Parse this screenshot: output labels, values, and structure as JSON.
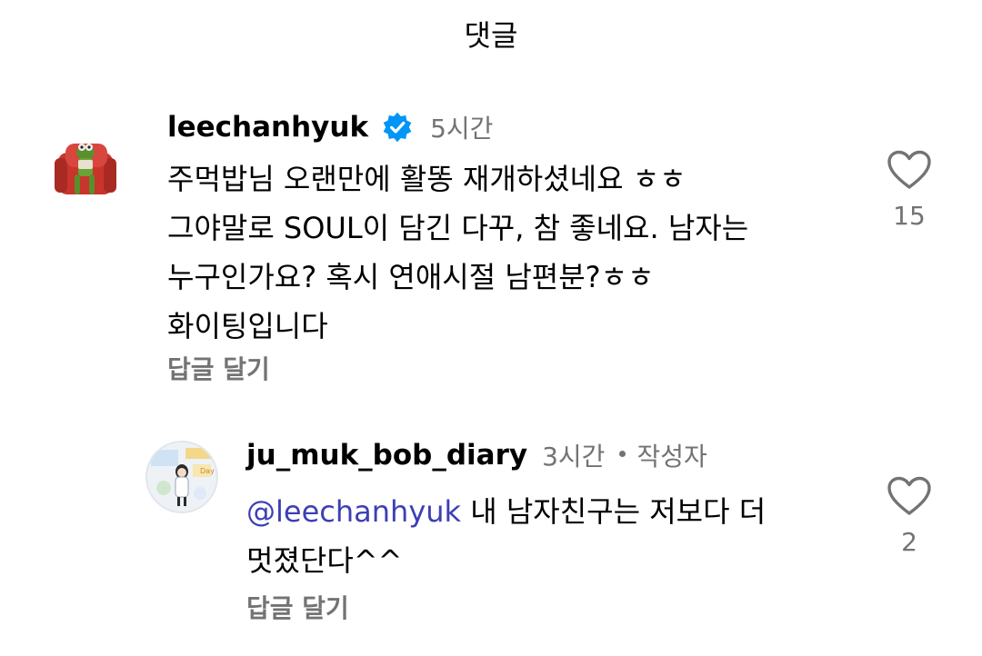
{
  "header": {
    "title": "댓글"
  },
  "comments": [
    {
      "username": "leechanhyuk",
      "time": "5시간",
      "lines": [
        "주먹밥님 오랜만에 활똥 재개하셨네요 ㅎㅎ",
        "그야말로 SOUL이 담긴 다꾸, 참 좋네요. 남자는",
        "누구인가요? 혹시 연애시절 남편분?ㅎㅎ",
        "화이팅입니다"
      ],
      "reply_label": "답글 달기",
      "likes": "15",
      "avatar_icon": "kermit-avatar-icon",
      "badge_icon": "verified-badge-icon",
      "badge_color": "#0095f6"
    }
  ],
  "replies": [
    {
      "username": "ju_muk_bob_diary",
      "time": "3시간",
      "author_label": "작성자",
      "mention": "@leechanhyuk",
      "text_line1": " 내 남자친구는 저보다 더",
      "text_line2": "멋졌단다^^",
      "reply_label": "답글 달기",
      "likes": "2",
      "avatar_icon": "diary-avatar-icon",
      "mention_color": "#3d3fb5"
    }
  ]
}
